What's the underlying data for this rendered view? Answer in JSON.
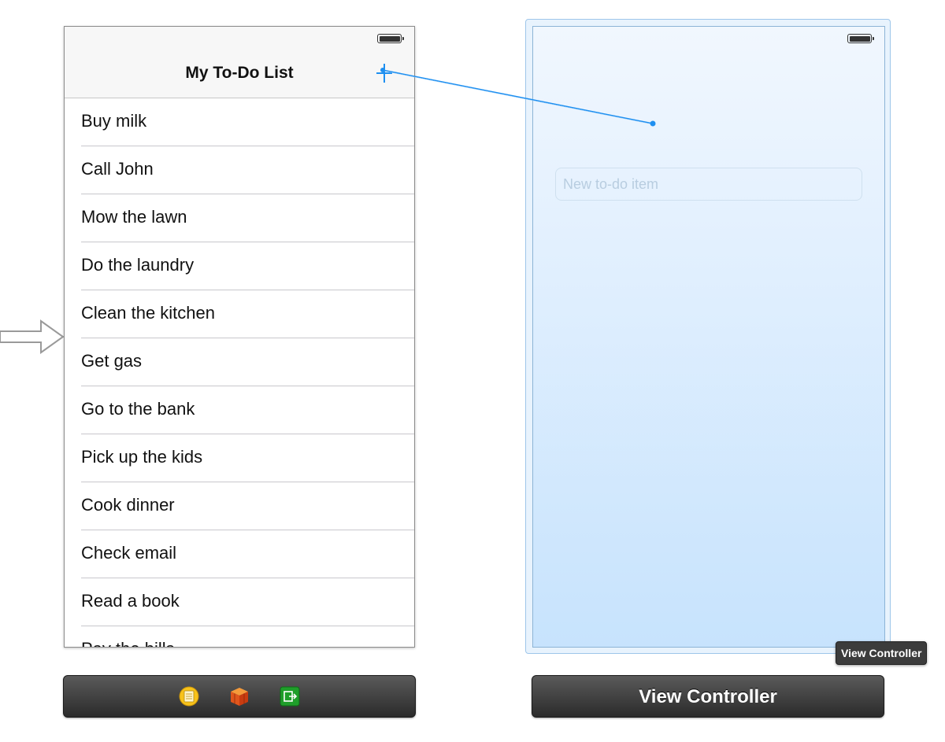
{
  "left_scene": {
    "nav_title": "My To-Do List",
    "cells": [
      {
        "label": "Buy milk"
      },
      {
        "label": "Call John"
      },
      {
        "label": "Mow the lawn"
      },
      {
        "label": "Do the laundry"
      },
      {
        "label": "Clean the kitchen"
      },
      {
        "label": "Get gas"
      },
      {
        "label": "Go to the bank"
      },
      {
        "label": "Pick up the kids"
      },
      {
        "label": "Cook dinner"
      },
      {
        "label": "Check email"
      },
      {
        "label": "Read a book"
      },
      {
        "label": "Pay the bills"
      }
    ],
    "dock_icons": [
      "first-responder-icon",
      "view-controller-cube-icon",
      "exit-icon"
    ]
  },
  "right_scene": {
    "text_field": {
      "placeholder": "New to-do item",
      "value": ""
    },
    "dock_title": "View Controller",
    "tooltip": "View Controller"
  },
  "colors": {
    "accent": "#1e8ff0",
    "dock_background": "#3a3a3a",
    "scene_selected_tint": "#c7e3fd"
  }
}
